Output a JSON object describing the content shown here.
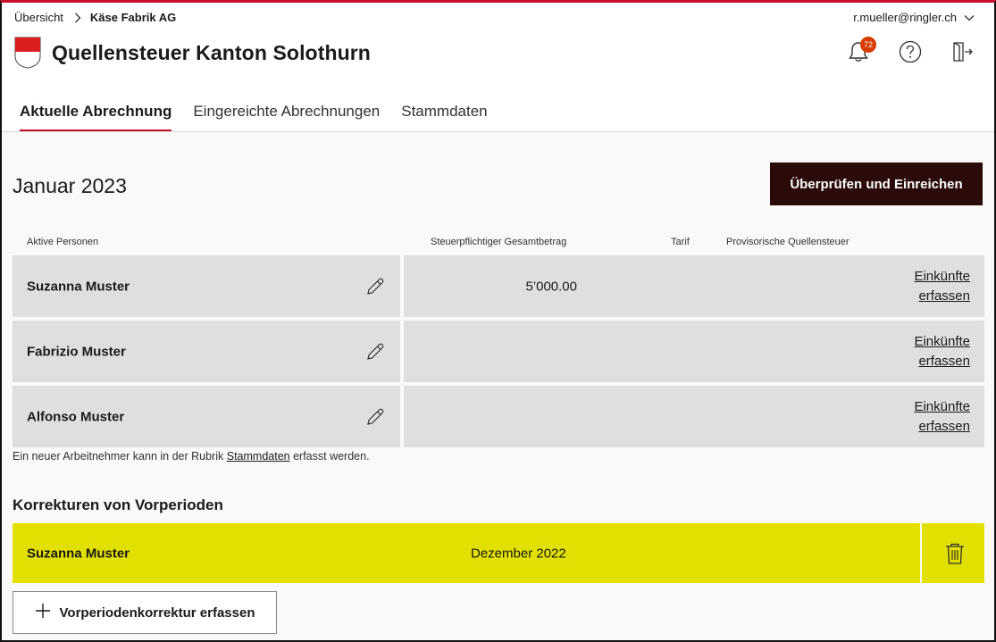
{
  "breadcrumb": {
    "home": "Übersicht",
    "current": "Käse Fabrik AG"
  },
  "user": {
    "email": "r.mueller@ringler.ch"
  },
  "header": {
    "title": "Quellensteuer Kanton Solothurn",
    "notifications_count": "72"
  },
  "tabs": [
    {
      "label": "Aktuelle Abrechnung",
      "active": true
    },
    {
      "label": "Eingereichte Abrechnungen",
      "active": false
    },
    {
      "label": "Stammdaten",
      "active": false
    }
  ],
  "main": {
    "period": "Januar 2023",
    "submit_label": "Überprüfen und Einreichen",
    "columns": {
      "persons": "Aktive Personen",
      "total": "Steuerpflichtiger Gesamtbetrag",
      "tariff": "Tarif",
      "provisional_tax": "Provisorische Quellensteuer"
    },
    "rows": [
      {
        "name": "Suzanna Muster",
        "amount": "5’000.00",
        "link_line1": "Einkünfte",
        "link_line2": "erfassen"
      },
      {
        "name": "Fabrizio Muster",
        "amount": "",
        "link_line1": "Einkünfte",
        "link_line2": "erfassen"
      },
      {
        "name": "Alfonso Muster",
        "amount": "",
        "link_line1": "Einkünfte",
        "link_line2": "erfassen"
      }
    ],
    "hint_before": "Ein neuer Arbeitnehmer kann in der Rubrik",
    "hint_link": "Stammdaten",
    "hint_after": "erfasst werden."
  },
  "corrections": {
    "title": "Korrekturen von Vorperioden",
    "rows": [
      {
        "name": "Suzanna Muster",
        "period": "Dezember 2022"
      }
    ],
    "add_label": "Vorperiodenkorrektur erfassen"
  },
  "colors": {
    "accent": "#c8102e",
    "primary_button": "#2b0a0a",
    "correction_row": "#e1e000",
    "row_bg": "#e1dfdd"
  }
}
